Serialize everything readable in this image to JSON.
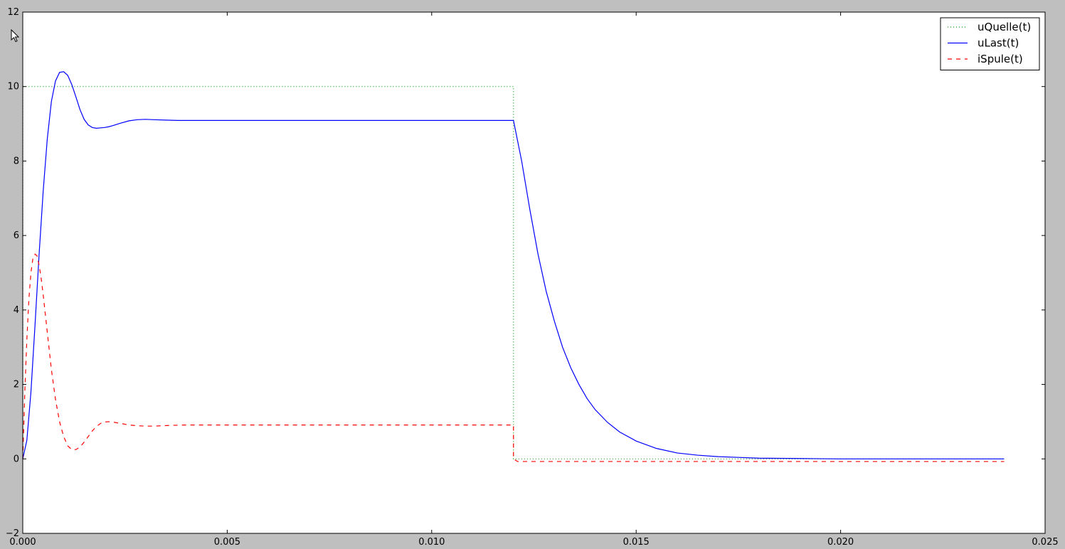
{
  "chart_data": {
    "type": "line",
    "title": "",
    "xlabel": "",
    "ylabel": "",
    "xlim": [
      0.0,
      0.025
    ],
    "ylim": [
      -2,
      12
    ],
    "x_ticks": [
      0.0,
      0.005,
      0.01,
      0.015,
      0.02,
      0.025
    ],
    "x_tick_labels": [
      "0.000",
      "0.005",
      "0.010",
      "0.015",
      "0.020",
      "0.025"
    ],
    "y_ticks": [
      -2,
      0,
      2,
      4,
      6,
      8,
      10,
      12
    ],
    "y_tick_labels": [
      "−2",
      "0",
      "2",
      "4",
      "6",
      "8",
      "10",
      "12"
    ],
    "grid": false,
    "legend_position": "top-right",
    "series": [
      {
        "name": "uQuelle(t)",
        "color": "#00a000",
        "style": "dotted",
        "x": [
          0.0,
          0.0,
          0.012,
          0.012,
          0.024
        ],
        "y": [
          0.0,
          10.0,
          10.0,
          0.0,
          0.0
        ]
      },
      {
        "name": "uLast(t)",
        "color": "#0000ff",
        "style": "solid",
        "x": [
          0.0,
          0.0001,
          0.0002,
          0.0003,
          0.0004,
          0.0005,
          0.0006,
          0.0007,
          0.0008,
          0.0009,
          0.001,
          0.0011,
          0.0012,
          0.0013,
          0.0014,
          0.0015,
          0.0016,
          0.0017,
          0.0018,
          0.0019,
          0.002,
          0.0021,
          0.0022,
          0.0024,
          0.0026,
          0.0028,
          0.003,
          0.0032,
          0.0035,
          0.0038,
          0.0042,
          0.005,
          0.008,
          0.012,
          0.0122,
          0.0124,
          0.0126,
          0.0128,
          0.013,
          0.0132,
          0.0134,
          0.0136,
          0.0138,
          0.014,
          0.0143,
          0.0146,
          0.015,
          0.0155,
          0.016,
          0.0165,
          0.017,
          0.0175,
          0.018,
          0.019,
          0.02,
          0.022,
          0.024
        ],
        "y": [
          0.0,
          0.5,
          1.8,
          3.6,
          5.5,
          7.2,
          8.6,
          9.6,
          10.15,
          10.38,
          10.4,
          10.3,
          10.05,
          9.72,
          9.38,
          9.12,
          8.97,
          8.9,
          8.88,
          8.89,
          8.9,
          8.92,
          8.95,
          9.02,
          9.08,
          9.11,
          9.12,
          9.11,
          9.1,
          9.09,
          9.09,
          9.09,
          9.09,
          9.09,
          8.0,
          6.7,
          5.5,
          4.5,
          3.7,
          3.0,
          2.45,
          2.0,
          1.62,
          1.32,
          0.98,
          0.72,
          0.48,
          0.28,
          0.16,
          0.1,
          0.06,
          0.04,
          0.02,
          0.01,
          0.0,
          0.0,
          0.0
        ]
      },
      {
        "name": "iSpule(t)",
        "color": "#ff0000",
        "style": "dashed",
        "x": [
          0.0,
          5e-05,
          0.0001,
          0.00015,
          0.0002,
          0.00025,
          0.0003,
          0.00035,
          0.0004,
          0.00045,
          0.0005,
          0.0006,
          0.0007,
          0.0008,
          0.0009,
          0.001,
          0.0011,
          0.0012,
          0.0013,
          0.0014,
          0.0015,
          0.0016,
          0.0017,
          0.0018,
          0.0019,
          0.002,
          0.0021,
          0.0022,
          0.0023,
          0.0024,
          0.0025,
          0.0026,
          0.0027,
          0.0028,
          0.003,
          0.0032,
          0.0034,
          0.0036,
          0.004,
          0.005,
          0.008,
          0.012,
          0.012,
          0.0121,
          0.016,
          0.02,
          0.024
        ],
        "y": [
          0.0,
          1.8,
          3.2,
          4.3,
          5.0,
          5.4,
          5.5,
          5.45,
          5.2,
          4.85,
          4.4,
          3.4,
          2.4,
          1.6,
          1.0,
          0.6,
          0.35,
          0.25,
          0.25,
          0.32,
          0.45,
          0.6,
          0.75,
          0.87,
          0.95,
          0.99,
          1.0,
          0.99,
          0.97,
          0.95,
          0.93,
          0.91,
          0.9,
          0.89,
          0.88,
          0.88,
          0.89,
          0.9,
          0.91,
          0.91,
          0.91,
          0.91,
          0.0,
          -0.07,
          -0.07,
          -0.07,
          -0.07
        ]
      }
    ]
  }
}
